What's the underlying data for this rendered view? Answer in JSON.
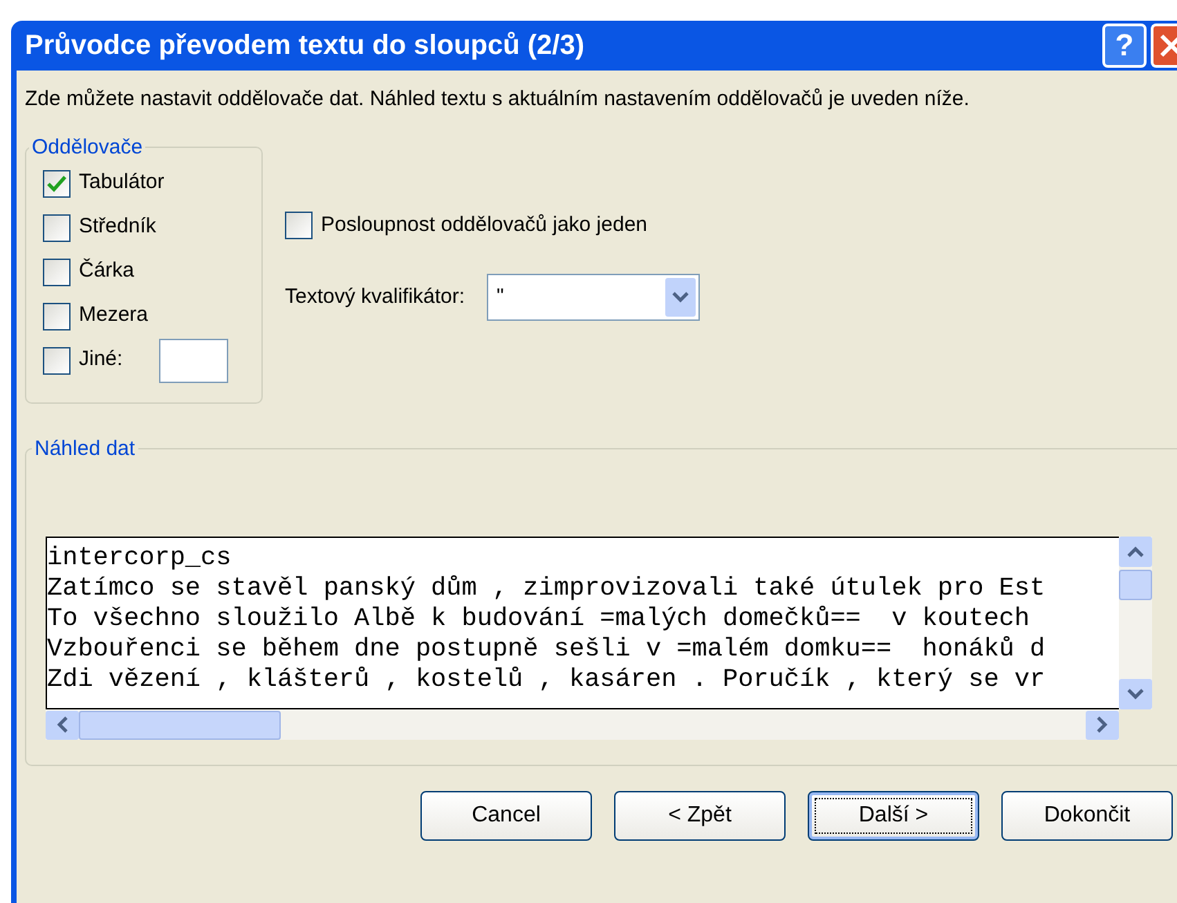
{
  "window": {
    "title": "Průvodce převodem textu do sloupců (2/3)",
    "title_buttons": [
      {
        "kind": "help",
        "label": "?"
      },
      {
        "kind": "close"
      }
    ]
  },
  "instructions": "Zde můžete nastavit oddělovače dat. Náhled textu s aktuálním nastavením oddělovačů je uveden níže.",
  "delimiters": {
    "title": "Oddělovače",
    "items": [
      {
        "label": "Tabulátor",
        "checked": true
      },
      {
        "label": "Středník",
        "checked": false
      },
      {
        "label": "Čárka",
        "checked": false
      },
      {
        "label": "Mezera",
        "checked": false
      },
      {
        "label": "Jiné:",
        "checked": false,
        "has_field": true
      }
    ]
  },
  "consecutive": {
    "label": "Posloupnost oddělovačů jako jeden",
    "checked": false
  },
  "qualifier": {
    "label": "Textový kvalifikátor:",
    "value": "\""
  },
  "preview": {
    "title": "Náhled dat",
    "lines": [
      "intercorp_cs",
      "Zatímco se stavěl panský dům , zimprovizovali také útulek pro Est",
      "To všechno sloužilo Albě k budování =malých domečků==  v koutech",
      "Vzbouřenci se během dne postupně sešli v =malém domku==  honáků d",
      "Zdi vězení , klášterů , kostelů , kasáren . Poručík , který se vr"
    ]
  },
  "buttons": [
    {
      "label": "Cancel",
      "focused": false
    },
    {
      "label": "< Zpět",
      "focused": false
    },
    {
      "label": "Další >",
      "focused": true
    },
    {
      "label": "Dokončit",
      "focused": false
    }
  ]
}
